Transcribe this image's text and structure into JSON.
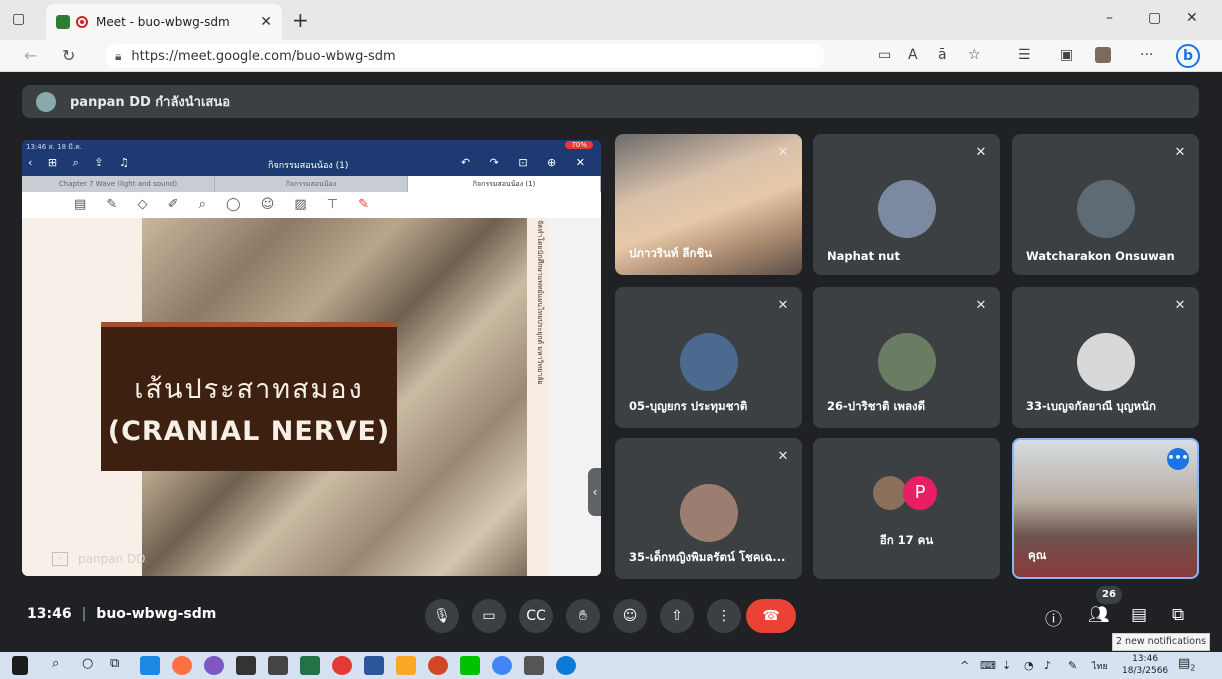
{
  "browser": {
    "tab_title": "Meet - buo-wbwg-sdm",
    "tab_close": "✕",
    "new_tab": "+",
    "url": "https://meet.google.com/buo-wbwg-sdm",
    "window_controls": {
      "minimize": "–",
      "restore": "▢",
      "close": "✕"
    }
  },
  "presenting_bar": {
    "text": "panpan DD กำลังนำเสนอ"
  },
  "shared_screen": {
    "status_time": "13:46  ส. 18 มี.ค.",
    "battery": "70%",
    "doc_title": "กิจกรรมสอนน้อง (1)",
    "tabs": [
      "Chapter 7 Wave (light and sound)",
      "กิจกรรมสอนน้อง",
      "กิจกรรมสอนน้อง (1)"
    ],
    "slide_title_line1": "เส้นประสาทสมอง",
    "slide_title_line2": "(CRANIAL NERVE)",
    "vertical_note": "จัดทำโดยนักศึกษาแพทย์แผนไทยประยุกต์ มหาวิทยาลัย",
    "presenter_name": "panpan DD"
  },
  "participants": [
    {
      "name": "ปภาวรินท์ ลีกชิน",
      "muted": true,
      "type": "video"
    },
    {
      "name": "Naphat nut",
      "muted": true,
      "type": "avatar",
      "color": "#7b8aa0"
    },
    {
      "name": "Watcharakon Onsuwan",
      "muted": true,
      "type": "avatar",
      "color": "#5f6b74"
    },
    {
      "name": "05-บุญยกร ประทุมชาติ",
      "muted": true,
      "type": "avatar",
      "color": "#4c6a8f"
    },
    {
      "name": "26-ปาริชาติ เพลงดี",
      "muted": true,
      "type": "avatar",
      "color": "#6a7d63"
    },
    {
      "name": "33-เบญจกัลยาณี บุญหนัก",
      "muted": true,
      "type": "avatar",
      "color": "#d8d8d8"
    },
    {
      "name": "35-เด็กหญิงพิมลรัตน์ โชคเฉ...",
      "muted": true,
      "type": "avatar",
      "color": "#9b7e70"
    },
    {
      "name": "อีก 17 คน",
      "type": "others",
      "avatar_letter": "P",
      "avatar_color": "#e91e63"
    },
    {
      "name": "คุณ",
      "type": "self-video",
      "more": "•••"
    }
  ],
  "bottom_bar": {
    "time": "13:46",
    "meeting_code": "buo-wbwg-sdm",
    "participant_count": "26",
    "notification": "2 new notifications"
  },
  "taskbar": {
    "time": "13:46",
    "date": "18/3/2566",
    "language": "ไทย",
    "notification_count": "2"
  }
}
